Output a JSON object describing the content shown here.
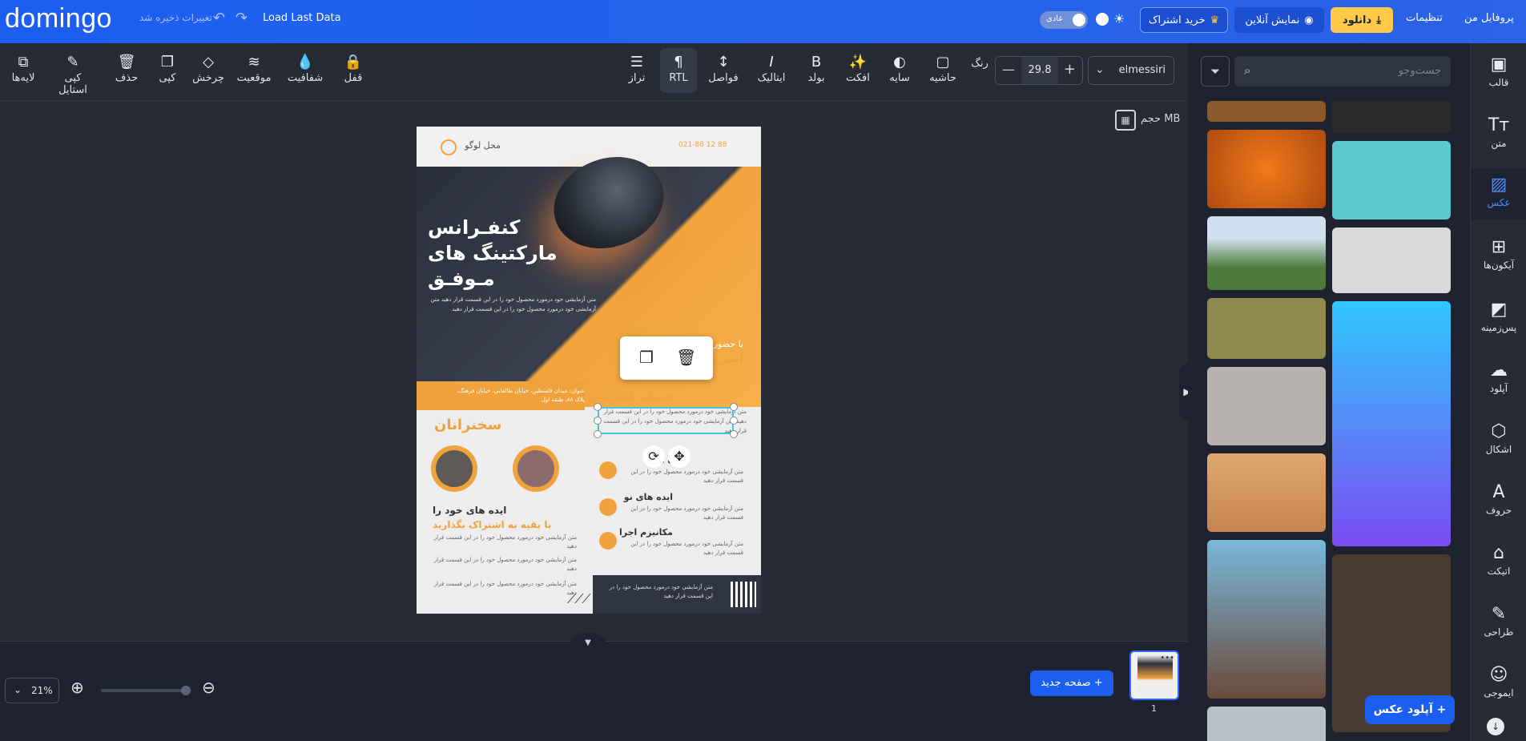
{
  "header": {
    "logo": "domingo",
    "save_status": "تغییرات ذخیره شد",
    "load_last": "Load Last Data",
    "mode_label": "عادی",
    "buy": "خرید اشتراک",
    "online": "نمایش آنلاین",
    "download": "دانلود",
    "settings": "تنظیمات",
    "profile": "پروفایل من"
  },
  "toolbar": {
    "layers": "لایه‌ها",
    "copy_style": "کپی استایل",
    "delete": "حذف",
    "copy": "کپی",
    "rotate": "چرخش",
    "position": "موقعیت",
    "opacity": "شفافیت",
    "lock": "قفل",
    "align": "تراز",
    "rtl": "RTL",
    "spacing": "فواصل",
    "italic": "ایتالیک",
    "bold": "بولد",
    "effect": "افکت",
    "shadow": "سایه",
    "border": "حاشیه",
    "color": "رنگ",
    "font_size": "29.8",
    "font_name": "elmessiri"
  },
  "canvas": {
    "size_label": "حجم MB"
  },
  "poster": {
    "logo_place": "محل لوگو",
    "phone": "021-88 12 88",
    "title": "کنفـرانس مارکتینگ های مـوفـق",
    "desc": "متن آزمایشی خود درمورد محصول خود را در این قسمت قرار دهید متن آزمایشی خود درمورد محصول خود را در این قسمت قرار دهید",
    "with": "با حضور",
    "name": "امیر ع",
    "address": "عنوان: میدان فلسطین، خیابان طالقانی، خیابان فرهنگ، پلاک ۸۸، طبقه اول",
    "services": "خدمات کنفرانس",
    "services_txt": "متن آزمایشی خود درمورد محصول خود را در این قسمت قرار دهید متن آزمایشی خود درمورد محصول خود را در این قسمت قرار دهید",
    "speakers": "سخنرانان",
    "feat1": "ه ها",
    "feat2": "ایده های نو",
    "feat3": "مکانیزم اجرا",
    "feat_txt": "متن آزمایشی خود درمورد محصول خود را در این قسمت قرار دهید",
    "ideas": "ایده های خود را",
    "join": "با بقیه به اشتراک بگذارید",
    "ideas_txt": "متن آزمایشی خود درمورد محصول خود را در این قسمت قرار دهید",
    "bullet1": "متن آزمایشی خود درمورد محصول خود را در این قسمت قرار دهید",
    "bullet2": "متن آزمایشی خود درمورد محصول خود را در این قسمت قرار دهید",
    "footer_txt": "متن آزمایشی خود درمورد محصول خود را در این قسمت قرار دهید"
  },
  "bottom": {
    "zoom": "21%",
    "new_page": "صفحه جدید +",
    "page_num": "1"
  },
  "panel": {
    "search_placeholder": "جست‌وجو",
    "upload_photo": "آپلود عکس +"
  },
  "sidebar": {
    "items": [
      "قالب",
      "متن",
      "عکس",
      "آیکون‌ها",
      "پس‌زمینه",
      "آپلود",
      "اشکال",
      "حروف",
      "اتیکت",
      "طراحی",
      "ایموجی"
    ]
  },
  "colors": {
    "brand_blue": "#1c5ef0",
    "download_yellow": "#ffc94a",
    "poster_orange": "#f0a33d",
    "poster_dark": "#2a2f3d",
    "selection": "#40c4e8"
  }
}
